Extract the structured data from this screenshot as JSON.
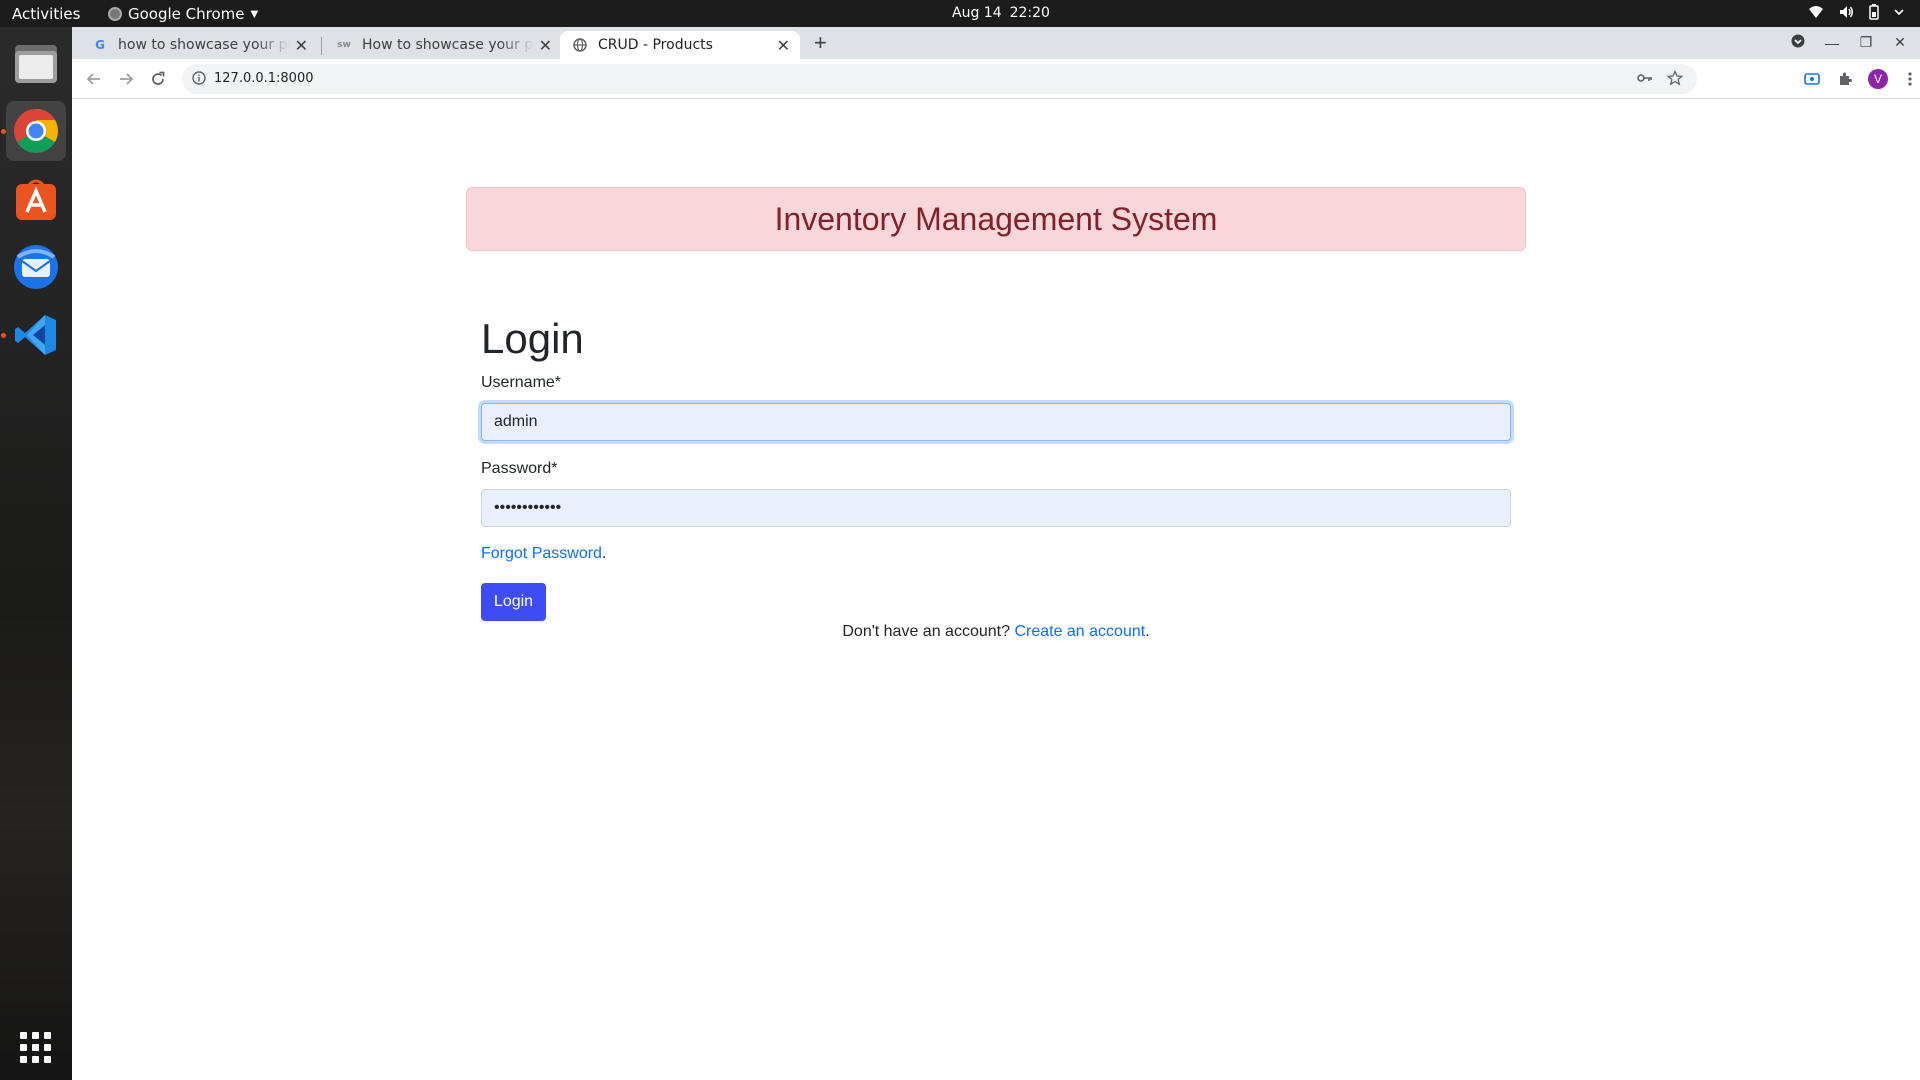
{
  "system_bar": {
    "activities": "Activities",
    "app_name": "Google Chrome",
    "date": "Aug 14",
    "time": "22:20"
  },
  "dock": {
    "apps": [
      "files-icon",
      "chrome-icon",
      "app-store-icon",
      "thunderbird-icon",
      "vscode-icon"
    ],
    "show_apps": "apps-grid-icon"
  },
  "browser": {
    "tabs": [
      {
        "title": "how to showcase your pro",
        "favicon": "google-icon",
        "active": false
      },
      {
        "title": "How to showcase your pro",
        "favicon": "site-icon",
        "active": false
      },
      {
        "title": "CRUD - Products",
        "favicon": "globe-icon",
        "active": true
      }
    ],
    "url": "127.0.0.1:8000",
    "profile_initial": "V"
  },
  "page": {
    "banner_title": "Inventory Management System",
    "heading": "Login",
    "username": {
      "label": "Username*",
      "value": "admin"
    },
    "password": {
      "label": "Password*",
      "value": "••••••••••••"
    },
    "forgot_link": "Forgot Password",
    "forgot_suffix": ".",
    "login_button": "Login",
    "signup_prompt": "Don't have an account?",
    "signup_link": "Create an account",
    "signup_suffix": "."
  },
  "colors": {
    "banner_bg": "#f8d7da",
    "banner_text": "#842029",
    "primary_button": "#3d4cf5",
    "link": "#0d6efd",
    "autofill_bg": "#e8f0fe"
  }
}
